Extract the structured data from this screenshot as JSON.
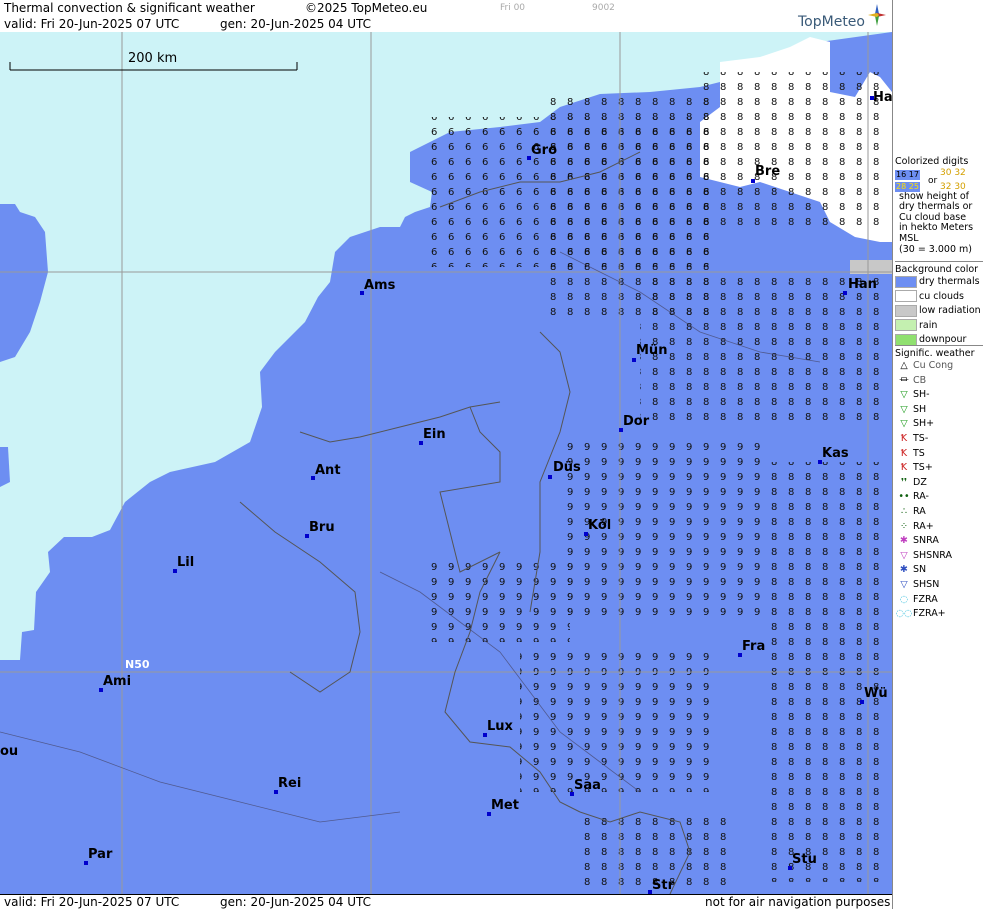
{
  "header": {
    "title": "Thermal convection & significant weather",
    "copyright": "©2025 TopMeteo.eu",
    "model_run": "Fri 00",
    "code": "9002",
    "valid": "valid:  Fri  20-Jun-2025  07 UTC",
    "gen": "gen: 20-Jun-2025 04 UTC",
    "logo": "TopMeteo"
  },
  "footer": {
    "valid": "valid:  Fri  20-Jun-2025  07 UTC",
    "gen": "gen: 20-Jun-2025 04 UTC",
    "disclaimer": "not for air navigation purposes"
  },
  "map": {
    "scale_label": "200 km",
    "lat_label": "N50",
    "colors": {
      "sea": "#cdf3f7",
      "dry": "#6d8ef2",
      "cu": "#ffffff",
      "low": "#c8c8c8"
    },
    "cities": [
      {
        "name": "Ha"
      },
      {
        "name": "Gro"
      },
      {
        "name": "Bre"
      },
      {
        "name": "Ams"
      },
      {
        "name": "Han"
      },
      {
        "name": "Mün"
      },
      {
        "name": "Dor"
      },
      {
        "name": "Ein"
      },
      {
        "name": "Kas"
      },
      {
        "name": "Ant"
      },
      {
        "name": "Düs"
      },
      {
        "name": "Köl"
      },
      {
        "name": "Bru"
      },
      {
        "name": "Lil"
      },
      {
        "name": "Fra"
      },
      {
        "name": "Ami"
      },
      {
        "name": "Wü"
      },
      {
        "name": "Lux"
      },
      {
        "name": "ou"
      },
      {
        "name": "Rei"
      },
      {
        "name": "Saa"
      },
      {
        "name": "Met"
      },
      {
        "name": "Stu"
      },
      {
        "name": "Par"
      },
      {
        "name": "Str"
      }
    ]
  },
  "legend": {
    "colorized": [
      "Colorized digits",
      "or",
      "show height of",
      "dry thermals or",
      "Cu cloud base",
      "in hekto Meters",
      "MSL",
      "(30 = 3.000 m)"
    ],
    "digits_sample": [
      "16 17",
      "30 32",
      "28 25",
      "32 30"
    ],
    "bg_title": "Background color",
    "bg_items": [
      {
        "label": "dry thermals",
        "color": "#6d8ef2"
      },
      {
        "label": "cu clouds",
        "color": "#ffffff"
      },
      {
        "label": "low radiation",
        "color": "#c8c8c8"
      },
      {
        "label": "rain",
        "color": "#c4f0b0"
      },
      {
        "label": "downpour",
        "color": "#90e070"
      }
    ],
    "sig_title": "Signific. weather",
    "sig_items": [
      {
        "label": "Cu Cong",
        "icon": "cu-cong",
        "glyph": "△",
        "color": "#000"
      },
      {
        "label": "CB",
        "icon": "cb",
        "glyph": "⏛",
        "color": "#000"
      },
      {
        "label": "SH-",
        "icon": "shower-light",
        "glyph": "▽",
        "color": "#1a9a1a"
      },
      {
        "label": "SH",
        "icon": "shower",
        "glyph": "▽",
        "color": "#1a9a1a"
      },
      {
        "label": "SH+",
        "icon": "shower-heavy",
        "glyph": "▽",
        "color": "#1a9a1a"
      },
      {
        "label": "TS-",
        "icon": "thunder-light",
        "glyph": "Ꝁ",
        "color": "#cc2020"
      },
      {
        "label": "TS",
        "icon": "thunder",
        "glyph": "Ꝁ",
        "color": "#cc2020"
      },
      {
        "label": "TS+",
        "icon": "thunder-heavy",
        "glyph": "Ꝁ",
        "color": "#cc2020"
      },
      {
        "label": "DZ",
        "icon": "drizzle",
        "glyph": "❜❜",
        "color": "#106010"
      },
      {
        "label": "RA-",
        "icon": "rain-light",
        "glyph": "••",
        "color": "#106010"
      },
      {
        "label": "RA",
        "icon": "rain",
        "glyph": "∴",
        "color": "#106010"
      },
      {
        "label": "RA+",
        "icon": "rain-heavy",
        "glyph": "⁘",
        "color": "#106010"
      },
      {
        "label": "SNRA",
        "icon": "snow-rain",
        "glyph": "✱",
        "color": "#c040c0"
      },
      {
        "label": "SHSNRA",
        "icon": "shower-snow-rain",
        "glyph": "▽",
        "color": "#c040c0"
      },
      {
        "label": "SN",
        "icon": "snow",
        "glyph": "✱",
        "color": "#3050c0"
      },
      {
        "label": "SHSN",
        "icon": "shower-snow",
        "glyph": "▽",
        "color": "#3050c0"
      },
      {
        "label": "FZRA",
        "icon": "freezing-rain",
        "glyph": "◌",
        "color": "#20b8d8"
      },
      {
        "label": "FZRA+",
        "icon": "freezing-rain-heavy",
        "glyph": "◌◌",
        "color": "#20b8d8"
      }
    ]
  }
}
